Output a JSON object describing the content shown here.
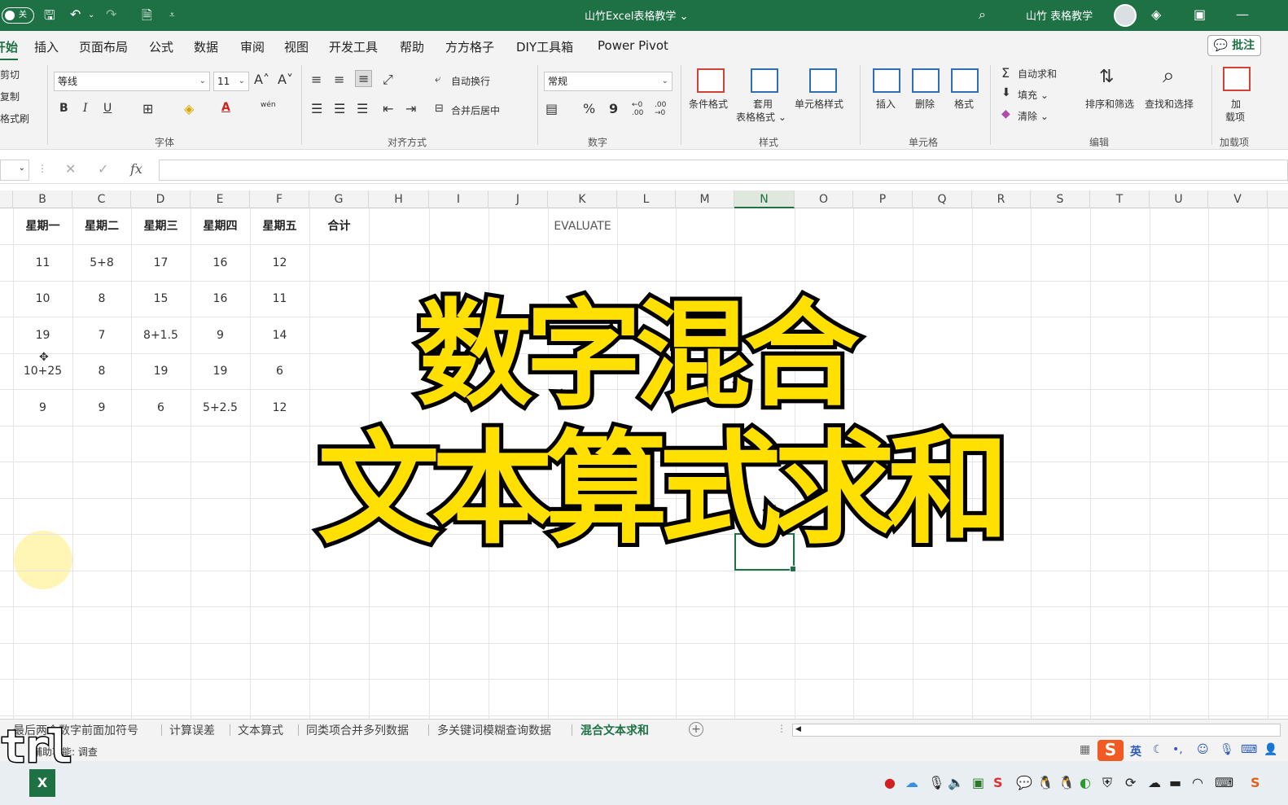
{
  "titlebar": {
    "autosave_label": "关",
    "title": "山竹Excel表格教学 ⌄",
    "user": "山竹 表格教学"
  },
  "menu": {
    "tabs": [
      "开始",
      "插入",
      "页面布局",
      "公式",
      "数据",
      "审阅",
      "视图",
      "开发工具",
      "帮助",
      "方方格子",
      "DIY工具箱",
      "Power Pivot"
    ],
    "comment_button": "批注"
  },
  "ribbon": {
    "clipboard": {
      "cut": "剪切",
      "copy": "复制",
      "format_painter": "格式刷"
    },
    "font": {
      "name": "等线",
      "size": "11",
      "grow": "A˄",
      "shrink": "A˅",
      "bold": "B",
      "italic": "I",
      "underline": "U",
      "font_color_label": "A",
      "phonetic": "wén",
      "group_label": "字体"
    },
    "alignment": {
      "wrap": "自动换行",
      "merge": "合并后居中",
      "group_label": "对齐方式"
    },
    "number": {
      "format": "常规",
      "percent": "%",
      "comma": "9",
      "increase_decimal": "←0 .00",
      "decrease_decimal": ".00 →0",
      "group_label": "数字"
    },
    "styles": {
      "conditional": "条件格式",
      "table_format_1": "套用",
      "table_format_2": "表格格式 ⌄",
      "cell_styles": "单元格样式",
      "group_label": "样式"
    },
    "cells": {
      "insert": "插入",
      "delete": "删除",
      "format": "格式",
      "group_label": "单元格"
    },
    "editing": {
      "autosum": "自动求和",
      "fill": "填充 ⌄",
      "clear": "清除 ⌄",
      "sort_filter": "排序和筛选",
      "find_select": "查找和选择",
      "group_label": "编辑"
    },
    "addins": {
      "label_1": "加",
      "label_2": "载项",
      "group_label": "加载项"
    }
  },
  "formula_bar": {
    "fx": "fx"
  },
  "columns": [
    "B",
    "C",
    "D",
    "E",
    "F",
    "G",
    "H",
    "I",
    "J",
    "K",
    "L",
    "M",
    "N",
    "O",
    "P",
    "Q",
    "R",
    "S",
    "T",
    "U",
    "V"
  ],
  "selected_column": "N",
  "table": {
    "headers": [
      "星期一",
      "星期二",
      "星期三",
      "星期四",
      "星期五",
      "合计"
    ],
    "rows": [
      [
        "11",
        "5+8",
        "17",
        "16",
        "12"
      ],
      [
        "10",
        "8",
        "15",
        "16",
        "11"
      ],
      [
        "19",
        "7",
        "8+1.5",
        "9",
        "14"
      ],
      [
        "10+25",
        "8",
        "19",
        "19",
        "6"
      ],
      [
        "9",
        "9",
        "6",
        "5+2.5",
        "12"
      ]
    ],
    "k_label": "EVALUATE"
  },
  "overlay": {
    "line1": "数字混合",
    "line2": "文本算式求和",
    "color": "#ffe000"
  },
  "sheets": {
    "tabs": [
      "最后两个数字前面加符号",
      "计算误差",
      "文本算式",
      "同类项合并多列数据",
      "多关键词模糊查询数据",
      "混合文本求和"
    ],
    "active_index": 5
  },
  "statusbar": {
    "text": "辅助功能: 调查",
    "ime_lang": "英"
  },
  "overlay_ctrl": "trl",
  "colors": {
    "accent": "#1e7145"
  }
}
